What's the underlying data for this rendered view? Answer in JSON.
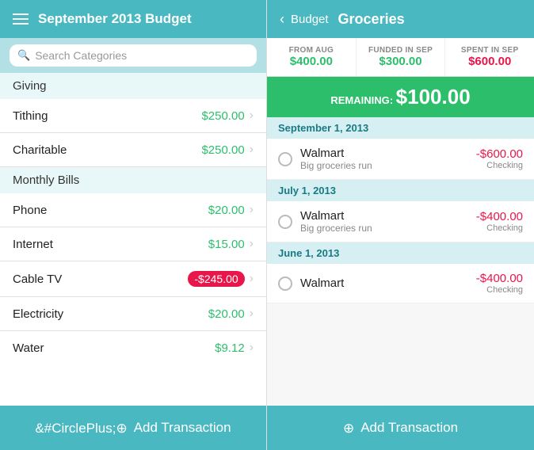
{
  "left": {
    "header": {
      "title": "September 2013 Budget"
    },
    "search": {
      "placeholder": "Search Categories"
    },
    "groups": [
      {
        "name": "Giving",
        "items": [
          {
            "name": "Tithing",
            "amount": "$250.00",
            "type": "green"
          },
          {
            "name": "Charitable",
            "amount": "$250.00",
            "type": "green"
          }
        ]
      },
      {
        "name": "Monthly Bills",
        "items": [
          {
            "name": "Phone",
            "amount": "$20.00",
            "type": "green"
          },
          {
            "name": "Internet",
            "amount": "$15.00",
            "type": "green"
          },
          {
            "name": "Cable TV",
            "amount": "-$245.00",
            "type": "red"
          },
          {
            "name": "Electricity",
            "amount": "$20.00",
            "type": "green"
          },
          {
            "name": "Water",
            "amount": "$9.12",
            "type": "green"
          }
        ]
      }
    ],
    "add_button": "Add Transaction"
  },
  "right": {
    "header": {
      "back_label": "Budget",
      "title": "Groceries"
    },
    "stats": [
      {
        "label": "FROM AUG",
        "value": "$400.00",
        "type": "green"
      },
      {
        "label": "FUNDED IN SEP",
        "value": "$300.00",
        "type": "green"
      },
      {
        "label": "SPENT IN SEP",
        "value": "$600.00",
        "type": "red"
      }
    ],
    "remaining": {
      "label": "REMAINING:",
      "amount": "$100.00"
    },
    "transaction_groups": [
      {
        "date": "September 1, 2013",
        "transactions": [
          {
            "name": "Walmart",
            "sub": "Big groceries run",
            "amount": "-$600.00",
            "account": "Checking"
          }
        ]
      },
      {
        "date": "July 1, 2013",
        "transactions": [
          {
            "name": "Walmart",
            "sub": "Big groceries run",
            "amount": "-$400.00",
            "account": "Checking"
          }
        ]
      },
      {
        "date": "June 1, 2013",
        "transactions": [
          {
            "name": "Walmart",
            "sub": "",
            "amount": "-$400.00",
            "account": "Checking"
          }
        ]
      }
    ],
    "add_button": "Add Transaction"
  }
}
